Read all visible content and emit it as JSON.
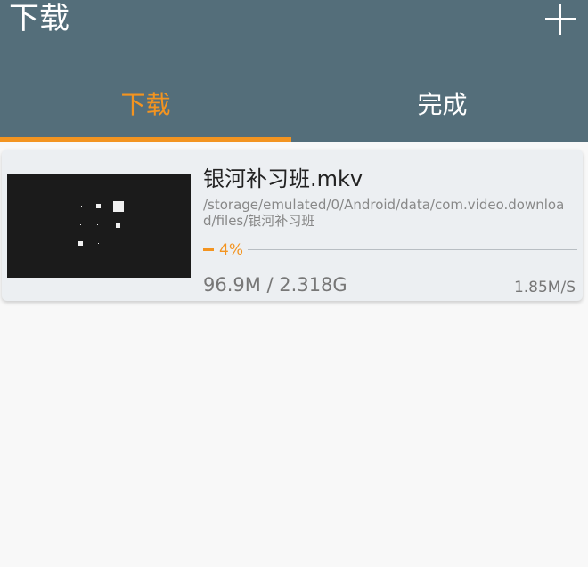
{
  "header": {
    "title": "下载",
    "add_icon": "plus-icon"
  },
  "tabs": [
    {
      "label": "下载",
      "active": true
    },
    {
      "label": "完成",
      "active": false
    }
  ],
  "colors": {
    "header_bg": "#546e7a",
    "accent": "#f39420"
  },
  "downloads": [
    {
      "file_name": "银河补习班.mkv",
      "path": "/storage/emulated/0/Android/data/com.video.download/files/银河补习班",
      "progress_text": "4%",
      "progress": 0.04,
      "size": "96.9M / 2.318G",
      "speed": "1.85M/S",
      "thumbnail_icon": "video-thumbnail"
    }
  ]
}
